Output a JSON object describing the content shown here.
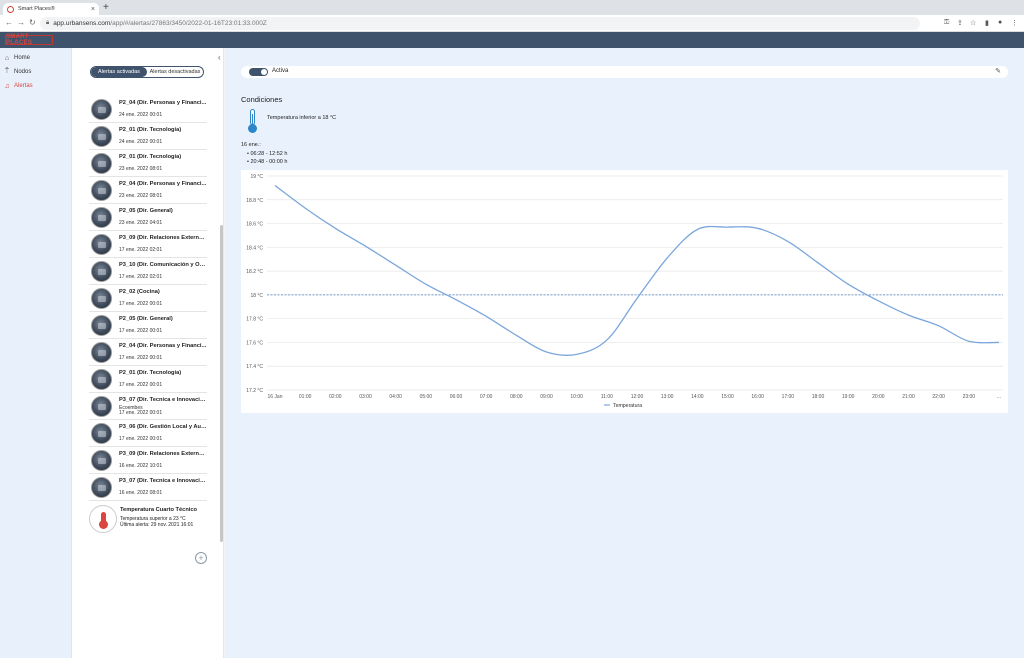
{
  "browser": {
    "tab_title": "Smart Places®",
    "tab_close": "×",
    "new_tab": "+",
    "url_host": "app.urbansens.com",
    "url_path": "/app/#/alertas/27863/3450/2022-01-16T23:01:33.000Z"
  },
  "app": {
    "logo": "SMART PLACES"
  },
  "nav": {
    "items": [
      {
        "label": "Home",
        "icon": "home-icon",
        "active": false
      },
      {
        "label": "Nodos",
        "icon": "antenna-icon",
        "active": false
      },
      {
        "label": "Alertas",
        "icon": "bell-icon",
        "active": true
      }
    ]
  },
  "alerts_panel": {
    "tab_active": "Alertas activadas",
    "tab_inactive": "Alertas desactivadas",
    "items": [
      {
        "name": "P2_04 (Dir. Personas y Financi...",
        "sub": "",
        "date": "24 ene. 2022 00:01"
      },
      {
        "name": "P2_01 (Dir. Tecnología)",
        "sub": "",
        "date": "24 ene. 2022 00:01"
      },
      {
        "name": "P2_01 (Dir. Tecnología)",
        "sub": "",
        "date": "23 ene. 2022 08:01"
      },
      {
        "name": "P2_04 (Dir. Personas y Financi...",
        "sub": "",
        "date": "23 ene. 2022 08:01"
      },
      {
        "name": "P2_05 (Dir. General)",
        "sub": "",
        "date": "23 ene. 2022 04:01"
      },
      {
        "name": "P3_09 (Dir. Relaciones Externas)",
        "sub": "",
        "date": "17 ene. 2022 02:01"
      },
      {
        "name": "P3_10 (Dir. Comunicación y Ofi...",
        "sub": "",
        "date": "17 ene. 2022 02:01"
      },
      {
        "name": "P2_02 (Cocina)",
        "sub": "",
        "date": "17 ene. 2022 00:01"
      },
      {
        "name": "P2_05 (Dir. General)",
        "sub": "",
        "date": "17 ene. 2022 00:01"
      },
      {
        "name": "P2_04 (Dir. Personas y Financi...",
        "sub": "",
        "date": "17 ene. 2022 00:01"
      },
      {
        "name": "P2_01 (Dir. Tecnología)",
        "sub": "",
        "date": "17 ene. 2022 00:01"
      },
      {
        "name": "P3_07 (Dir. Tecnica e Innovación)",
        "sub": "Ecoembes",
        "date": "17 ene. 2022 00:01"
      },
      {
        "name": "P3_06 (Dir. Gestión Local y Aut...",
        "sub": "",
        "date": "17 ene. 2022 00:01"
      },
      {
        "name": "P3_09 (Dir. Relaciones Externas)",
        "sub": "",
        "date": "16 ene. 2022 10:01"
      },
      {
        "name": "P3_07 (Dir. Tecnica e Innovación)",
        "sub": "",
        "date": "16 ene. 2022 08:01"
      }
    ],
    "temp_alert": {
      "name": "Temperatura Cuarto Técnico",
      "line2": "Temperatura superior a 23 °C",
      "line3": "Última alerta: 29 nov. 2021 16:01"
    },
    "add": "+"
  },
  "main": {
    "status_label": "Activa",
    "conditions_title": "Condiciones",
    "condition_text": "Temperatura inferior a 18 °C",
    "schedule_date": "16 ene.:",
    "schedule": [
      "• 06:28 - 12:52 h",
      "• 20:48 - 00:00 h"
    ]
  },
  "chart_data": {
    "type": "line",
    "x": [
      "16 Jan",
      "01:00",
      "02:00",
      "03:00",
      "04:00",
      "05:00",
      "06:00",
      "07:00",
      "08:00",
      "09:00",
      "10:00",
      "11:00",
      "12:00",
      "13:00",
      "14:00",
      "15:00",
      "16:00",
      "17:00",
      "18:00",
      "19:00",
      "20:00",
      "21:00",
      "22:00",
      "23:00",
      "..."
    ],
    "series": [
      {
        "name": "Temperatura",
        "color": "#7aa6dc",
        "values": [
          18.92,
          18.73,
          18.56,
          18.41,
          18.25,
          18.09,
          17.96,
          17.82,
          17.66,
          17.52,
          17.5,
          17.62,
          17.97,
          18.31,
          18.55,
          18.57,
          18.56,
          18.45,
          18.27,
          18.09,
          17.95,
          17.83,
          17.74,
          17.61,
          17.6
        ]
      }
    ],
    "threshold": {
      "value": 18,
      "color": "#4a7fc1"
    },
    "yticks": [
      17.2,
      17.4,
      17.6,
      17.8,
      18,
      18.2,
      18.4,
      18.6,
      18.8,
      19
    ],
    "ytick_labels": [
      "17.2 °C",
      "17.4 °C",
      "17.6 °C",
      "17.8 °C",
      "18 °C",
      "18.2 °C",
      "18.4 °C",
      "18.6 °C",
      "18.8 °C",
      "19 °C"
    ],
    "ylim": [
      17.2,
      19
    ],
    "grid": true,
    "legend": "bottom-center"
  }
}
